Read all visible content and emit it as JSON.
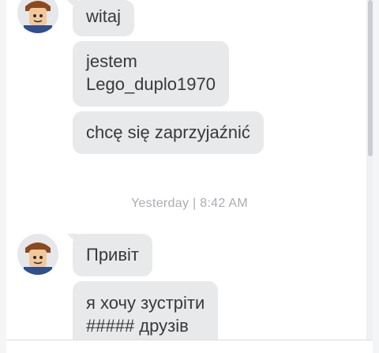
{
  "conversation": {
    "messages": [
      {
        "text": "witaj"
      },
      {
        "text_lines": [
          "jestem",
          "Lego_duplo1970"
        ]
      },
      {
        "text": "chcę się zaprzyjaźnić"
      },
      {
        "text": "Привіт"
      },
      {
        "text_lines": [
          "я хочу зустріти",
          "##### друзів"
        ]
      }
    ],
    "timestamp": "Yesterday | 8:42 AM"
  },
  "colors": {
    "bubble": "#e8e9eb",
    "text": "#39393c",
    "timestamp": "#a9adb3",
    "background": "#ffffff"
  },
  "icons": {
    "avatar": "avatar-icon"
  }
}
